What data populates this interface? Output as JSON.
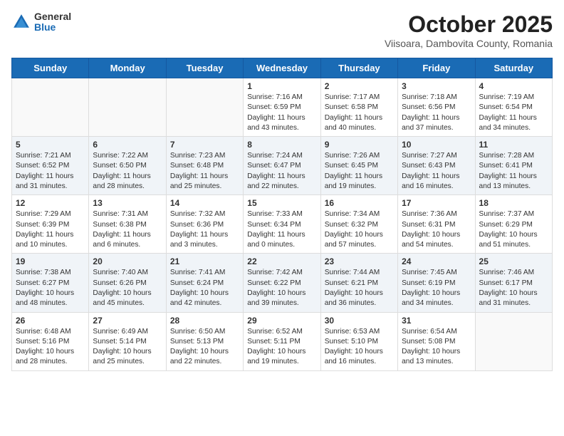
{
  "header": {
    "logo_general": "General",
    "logo_blue": "Blue",
    "month_title": "October 2025",
    "subtitle": "Viisoara, Dambovita County, Romania"
  },
  "days_of_week": [
    "Sunday",
    "Monday",
    "Tuesday",
    "Wednesday",
    "Thursday",
    "Friday",
    "Saturday"
  ],
  "weeks": [
    [
      {
        "day": "",
        "info": ""
      },
      {
        "day": "",
        "info": ""
      },
      {
        "day": "",
        "info": ""
      },
      {
        "day": "1",
        "info": "Sunrise: 7:16 AM\nSunset: 6:59 PM\nDaylight: 11 hours\nand 43 minutes."
      },
      {
        "day": "2",
        "info": "Sunrise: 7:17 AM\nSunset: 6:58 PM\nDaylight: 11 hours\nand 40 minutes."
      },
      {
        "day": "3",
        "info": "Sunrise: 7:18 AM\nSunset: 6:56 PM\nDaylight: 11 hours\nand 37 minutes."
      },
      {
        "day": "4",
        "info": "Sunrise: 7:19 AM\nSunset: 6:54 PM\nDaylight: 11 hours\nand 34 minutes."
      }
    ],
    [
      {
        "day": "5",
        "info": "Sunrise: 7:21 AM\nSunset: 6:52 PM\nDaylight: 11 hours\nand 31 minutes."
      },
      {
        "day": "6",
        "info": "Sunrise: 7:22 AM\nSunset: 6:50 PM\nDaylight: 11 hours\nand 28 minutes."
      },
      {
        "day": "7",
        "info": "Sunrise: 7:23 AM\nSunset: 6:48 PM\nDaylight: 11 hours\nand 25 minutes."
      },
      {
        "day": "8",
        "info": "Sunrise: 7:24 AM\nSunset: 6:47 PM\nDaylight: 11 hours\nand 22 minutes."
      },
      {
        "day": "9",
        "info": "Sunrise: 7:26 AM\nSunset: 6:45 PM\nDaylight: 11 hours\nand 19 minutes."
      },
      {
        "day": "10",
        "info": "Sunrise: 7:27 AM\nSunset: 6:43 PM\nDaylight: 11 hours\nand 16 minutes."
      },
      {
        "day": "11",
        "info": "Sunrise: 7:28 AM\nSunset: 6:41 PM\nDaylight: 11 hours\nand 13 minutes."
      }
    ],
    [
      {
        "day": "12",
        "info": "Sunrise: 7:29 AM\nSunset: 6:39 PM\nDaylight: 11 hours\nand 10 minutes."
      },
      {
        "day": "13",
        "info": "Sunrise: 7:31 AM\nSunset: 6:38 PM\nDaylight: 11 hours\nand 6 minutes."
      },
      {
        "day": "14",
        "info": "Sunrise: 7:32 AM\nSunset: 6:36 PM\nDaylight: 11 hours\nand 3 minutes."
      },
      {
        "day": "15",
        "info": "Sunrise: 7:33 AM\nSunset: 6:34 PM\nDaylight: 11 hours\nand 0 minutes."
      },
      {
        "day": "16",
        "info": "Sunrise: 7:34 AM\nSunset: 6:32 PM\nDaylight: 10 hours\nand 57 minutes."
      },
      {
        "day": "17",
        "info": "Sunrise: 7:36 AM\nSunset: 6:31 PM\nDaylight: 10 hours\nand 54 minutes."
      },
      {
        "day": "18",
        "info": "Sunrise: 7:37 AM\nSunset: 6:29 PM\nDaylight: 10 hours\nand 51 minutes."
      }
    ],
    [
      {
        "day": "19",
        "info": "Sunrise: 7:38 AM\nSunset: 6:27 PM\nDaylight: 10 hours\nand 48 minutes."
      },
      {
        "day": "20",
        "info": "Sunrise: 7:40 AM\nSunset: 6:26 PM\nDaylight: 10 hours\nand 45 minutes."
      },
      {
        "day": "21",
        "info": "Sunrise: 7:41 AM\nSunset: 6:24 PM\nDaylight: 10 hours\nand 42 minutes."
      },
      {
        "day": "22",
        "info": "Sunrise: 7:42 AM\nSunset: 6:22 PM\nDaylight: 10 hours\nand 39 minutes."
      },
      {
        "day": "23",
        "info": "Sunrise: 7:44 AM\nSunset: 6:21 PM\nDaylight: 10 hours\nand 36 minutes."
      },
      {
        "day": "24",
        "info": "Sunrise: 7:45 AM\nSunset: 6:19 PM\nDaylight: 10 hours\nand 34 minutes."
      },
      {
        "day": "25",
        "info": "Sunrise: 7:46 AM\nSunset: 6:17 PM\nDaylight: 10 hours\nand 31 minutes."
      }
    ],
    [
      {
        "day": "26",
        "info": "Sunrise: 6:48 AM\nSunset: 5:16 PM\nDaylight: 10 hours\nand 28 minutes."
      },
      {
        "day": "27",
        "info": "Sunrise: 6:49 AM\nSunset: 5:14 PM\nDaylight: 10 hours\nand 25 minutes."
      },
      {
        "day": "28",
        "info": "Sunrise: 6:50 AM\nSunset: 5:13 PM\nDaylight: 10 hours\nand 22 minutes."
      },
      {
        "day": "29",
        "info": "Sunrise: 6:52 AM\nSunset: 5:11 PM\nDaylight: 10 hours\nand 19 minutes."
      },
      {
        "day": "30",
        "info": "Sunrise: 6:53 AM\nSunset: 5:10 PM\nDaylight: 10 hours\nand 16 minutes."
      },
      {
        "day": "31",
        "info": "Sunrise: 6:54 AM\nSunset: 5:08 PM\nDaylight: 10 hours\nand 13 minutes."
      },
      {
        "day": "",
        "info": ""
      }
    ]
  ]
}
